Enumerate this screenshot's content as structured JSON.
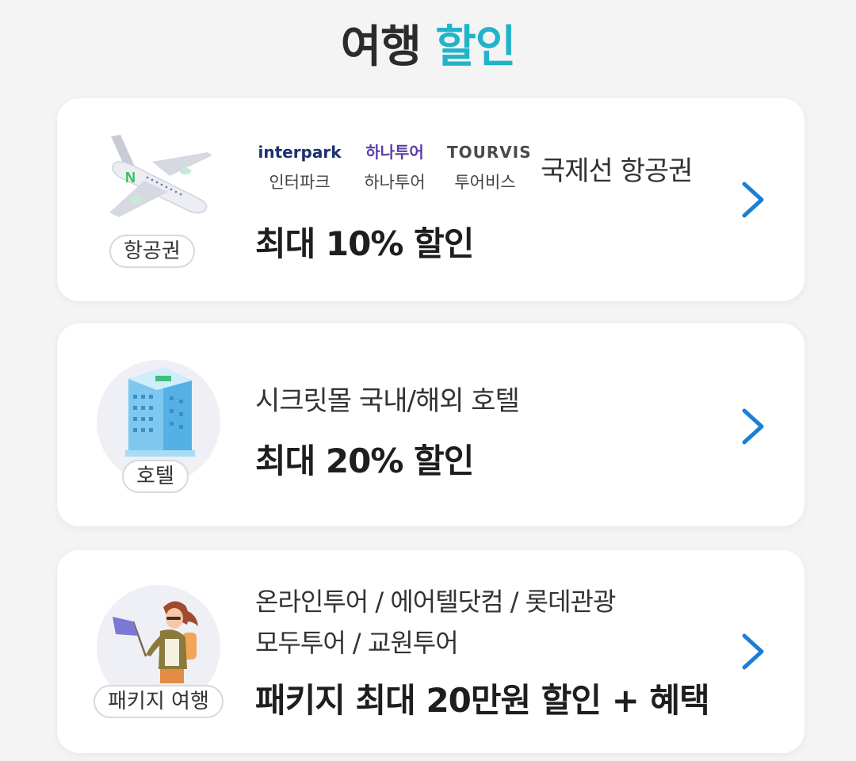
{
  "header": {
    "title_part1": "여행",
    "title_part2": "할인"
  },
  "cards": [
    {
      "badge": "항공권",
      "partners": [
        {
          "logo": "interpark",
          "name": "인터파크"
        },
        {
          "logo": "하나투어",
          "name": "하나투어"
        },
        {
          "logo": "TOURVIS",
          "name": "투어비스"
        }
      ],
      "category": "국제선 항공권",
      "headline": "최대 10% 할인"
    },
    {
      "badge": "호텔",
      "subtitle": "시크릿몰 국내/해외 호텔",
      "headline": "최대 20% 할인"
    },
    {
      "badge": "패키지 여행",
      "subtitle_line1": "온라인투어 / 에어텔닷컴 / 롯데관광",
      "subtitle_line2": "모두투어 / 교원투어",
      "headline": "패키지 최대 20만원 할인 + 혜택"
    }
  ],
  "colors": {
    "accent": "#22b3c9",
    "chevron": "#1a7fd6",
    "interpark": "#1e2f6e",
    "hanatour": "#5b3fa6",
    "tourvis": "#4a4a4a"
  },
  "icons": {
    "airplane": "airplane-illustration",
    "hotel": "hotel-building-illustration",
    "package": "traveler-with-flag-illustration",
    "chevron": "chevron-right-icon"
  }
}
